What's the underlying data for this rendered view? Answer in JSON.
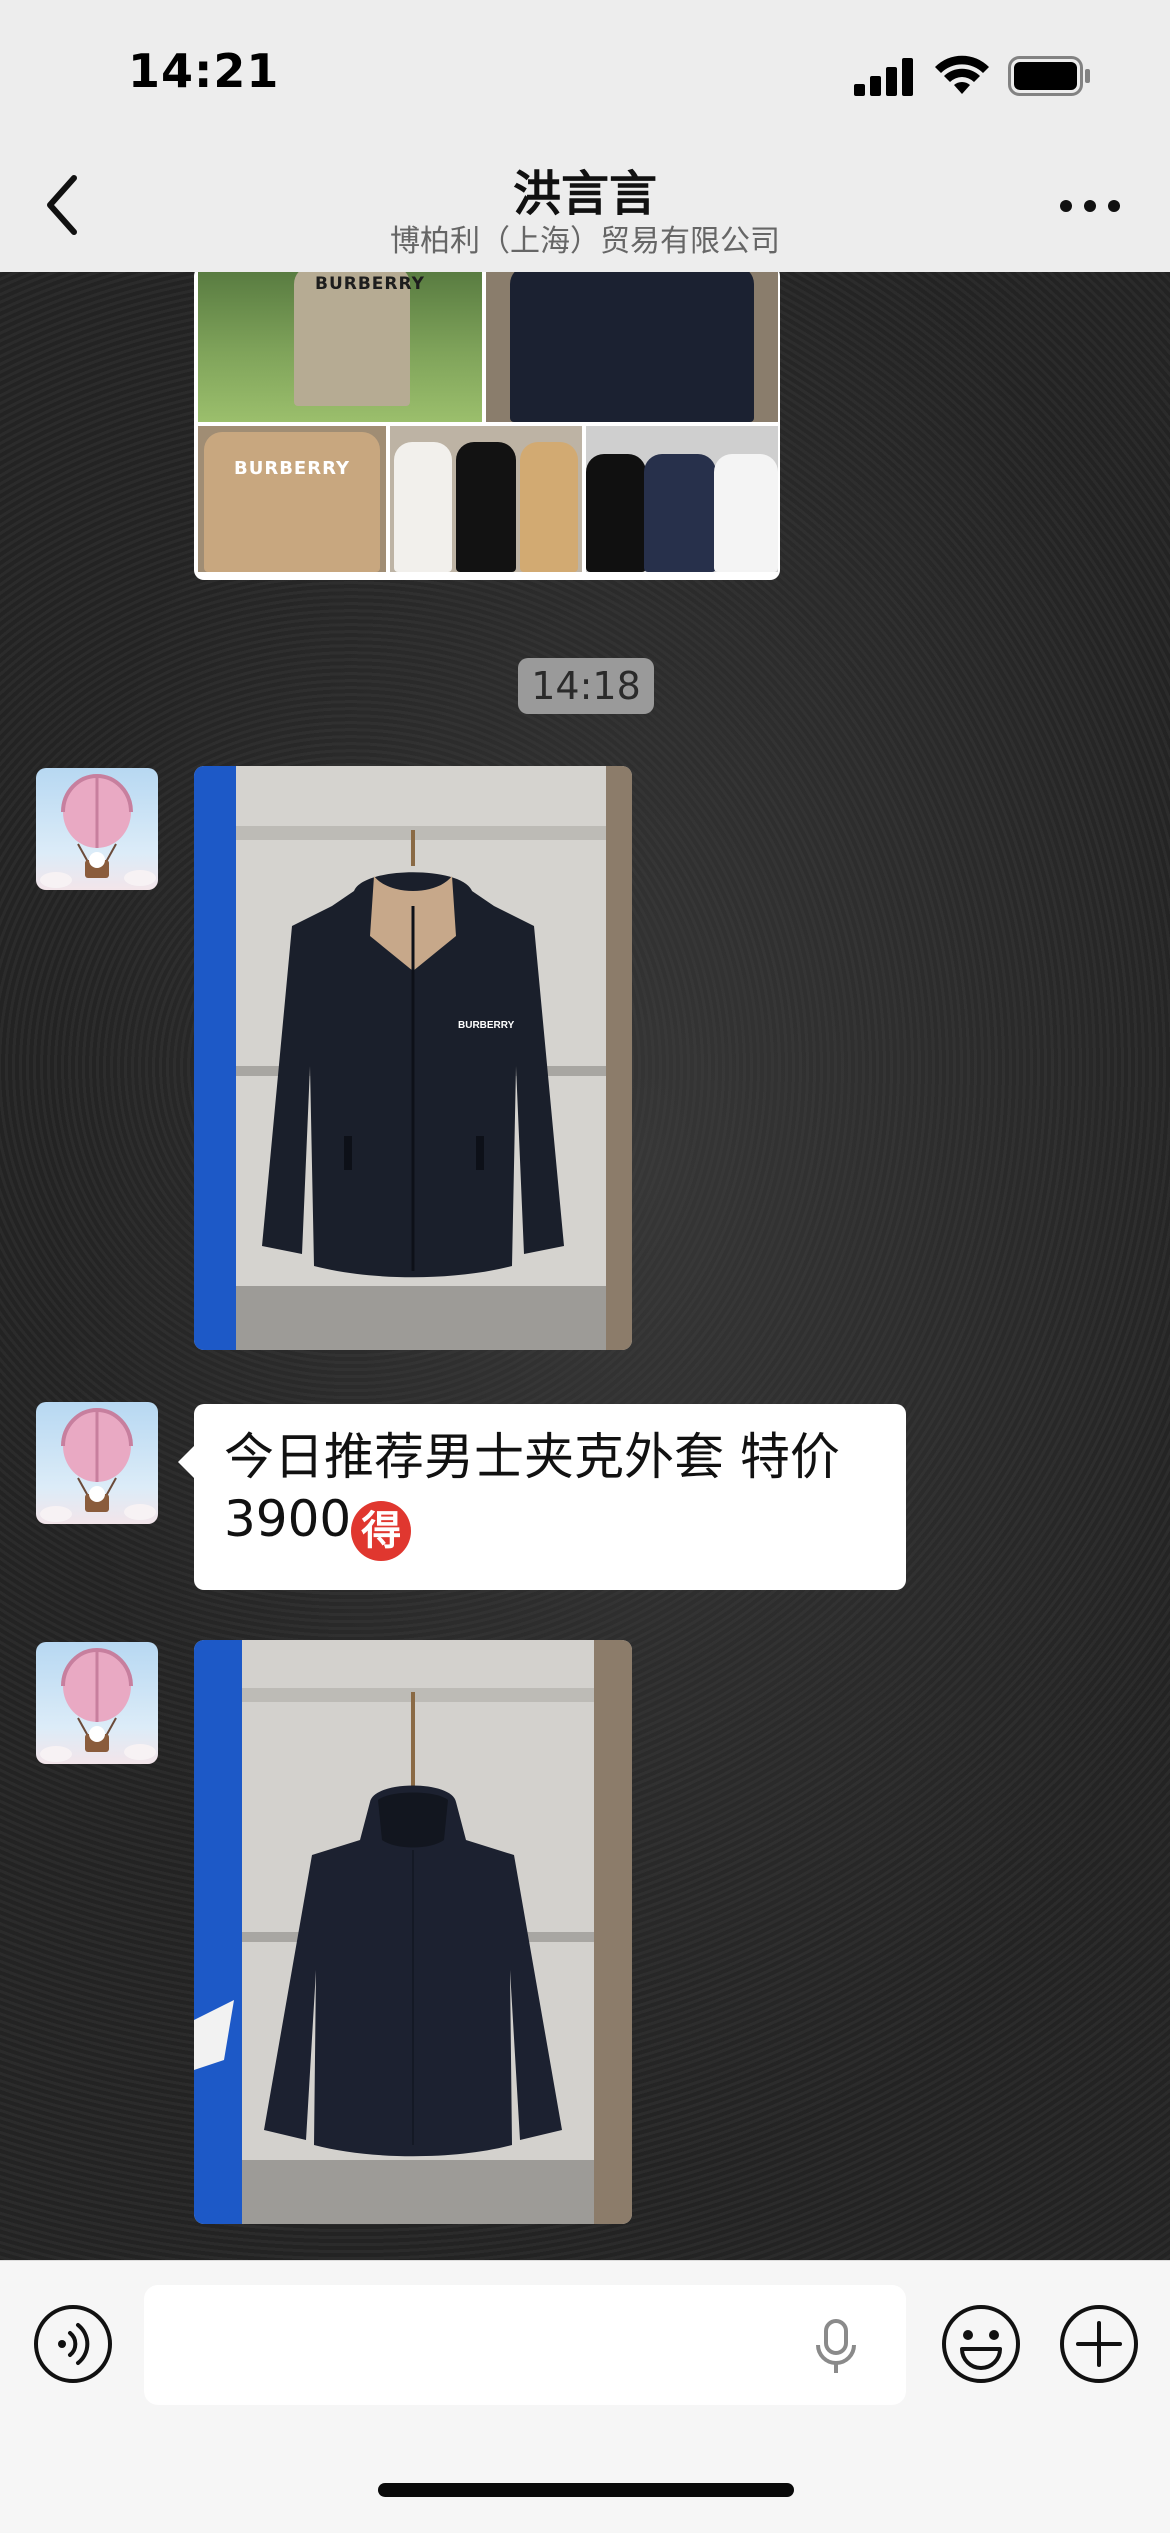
{
  "status_bar": {
    "time": "14:21",
    "icons": [
      "signal-icon",
      "wifi-icon",
      "battery-icon"
    ]
  },
  "header": {
    "title": "洪言言",
    "subtitle": "博柏利（上海）贸易有限公司",
    "back_icon": "chevron-left-icon",
    "more_icon": "more-dots-icon"
  },
  "chat": {
    "photo_grid_brand": "BURBERRY",
    "timestamp": "14:18",
    "jacket_brand": "BURBERRY",
    "text_message": "今日推荐男士夹克外套 特价3900",
    "text_emoji": "得"
  },
  "input_bar": {
    "icons": [
      "voice-toggle-icon",
      "microphone-icon",
      "emoji-icon",
      "plus-icon"
    ]
  },
  "colors": {
    "header_bg": "#ededed",
    "chat_bg": "#262626",
    "bubble_bg": "#ffffff",
    "timestamp_bg": "#9a9a9a",
    "emoji_red": "#e0372f"
  }
}
